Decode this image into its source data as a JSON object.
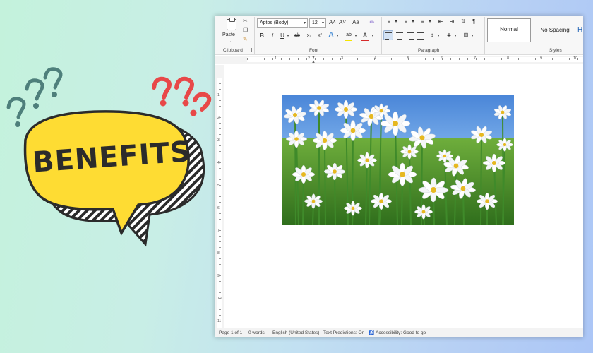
{
  "art": {
    "banner_text": "BENEFITS"
  },
  "ribbon": {
    "clipboard": {
      "paste_label": "Paste",
      "group_label": "Clipboard"
    },
    "font": {
      "font_name": "Aptos (Body)",
      "font_size": "12",
      "grow": "A˄",
      "shrink": "A˅",
      "change_case": "Aa",
      "bold": "B",
      "italic": "I",
      "underline": "U",
      "strike": "ab",
      "subscript": "x₂",
      "superscript": "x²",
      "text_effects": "A",
      "highlight": "ab",
      "font_color": "A",
      "group_label": "Font"
    },
    "paragraph": {
      "pilcrow": "¶",
      "group_label": "Paragraph"
    },
    "styles": {
      "normal": "Normal",
      "no_spacing": "No Spacing",
      "heading": "H",
      "group_label": "Styles"
    }
  },
  "ruler": {
    "numbers": [
      "1",
      "2",
      "3",
      "4",
      "5",
      "6",
      "7",
      "8",
      "9",
      "10"
    ]
  },
  "vruler": {
    "numbers": [
      "1",
      "2",
      "3",
      "4",
      "5",
      "6",
      "7",
      "8",
      "9",
      "10",
      "11"
    ]
  },
  "status": {
    "page": "Page 1 of 1",
    "words": "0 words",
    "language": "English (United States)",
    "predictions": "Text Predictions: On",
    "accessibility": "Accessibility: Good to go"
  },
  "colors": {
    "highlight": "#f5e400",
    "font_color": "#d62b2b",
    "accent_blue": "#1a5fb4"
  }
}
